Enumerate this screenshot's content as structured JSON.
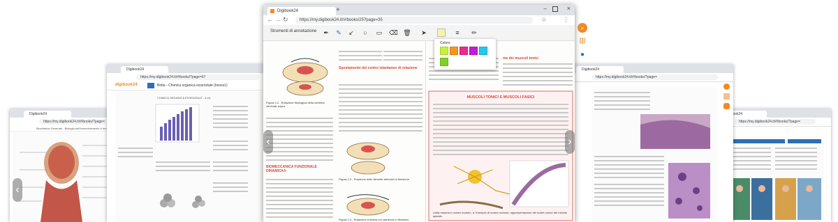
{
  "background_windows": {
    "far_left": {
      "tab_title": "Digibook24",
      "address": "https://my.digibook24.it/#/books/?page=",
      "top_label": "Biochimica Generale - Biologia dell'invecchiamento e funzioni"
    },
    "left": {
      "tab_title": "Digibook24",
      "address": "https://my.digibook24.it/#/books/?page=67",
      "book_title": "Botta - Chimica organica essenziale (booss1)",
      "brand": "digibook24",
      "page_header": "CHIMICA ORGANICA ESSENZIALE - 6 ed."
    },
    "right": {
      "tab_title": "Digibook24",
      "address": "https://my.digibook24.it/#/books/?page="
    },
    "far_right": {
      "tab_title": "Digibook24",
      "address": "https://my.digibook24.it/#/books/?page="
    }
  },
  "main_window": {
    "tab_title": "Digibook24",
    "address": "https://my.digibook24.it/#/books/25?page=35",
    "toolbar": {
      "title": "Strumenti di annotazione",
      "tools": [
        "pen-icon",
        "highlighter-icon",
        "arrow-icon",
        "circle-icon",
        "rectangle-icon",
        "eraser-icon",
        "trash-icon",
        "pointer-icon",
        "color-icon",
        "line-weight-icon",
        "pencil-icon"
      ]
    },
    "color_popup": {
      "label": "Colore",
      "colors": [
        "#c6f238",
        "#f7941d",
        "#ea2b8c",
        "#c41bd6",
        "#21c9ef",
        "#7ed321"
      ]
    },
    "left_page": {
      "heading_red_1": "Spostamento del centro istantaneo di rotazione",
      "heading_red_2": "BIOMECCANICA FUNZIONALE DINAMICA®",
      "figure_caption_1": "Figura 2.2 - Rotazione fisiologica della vertebra cervicale sopra.",
      "figure_caption_2": "Figura 2.3 - Posizione delle faccette articolari in flessione.",
      "figure_caption_3": "Figura 2.4 - Rotazione a destra con partenza in flessione."
    },
    "right_page": {
      "heading_red": "me dei muscoli tonici",
      "box_title": "MUSCOLI TONICI E MUSCOLI FASICI",
      "box_caption": "Unità motoria e nucleo motorio. a. Esempio di nucleo motorio; rappresentazione dei nuclei motori del midollo spinale."
    },
    "colors": {
      "accent": "#f08a24",
      "sidebar_icon_blue": "#1a73c8",
      "red_heading": "#d8453b",
      "bg": "#ffffff"
    }
  }
}
